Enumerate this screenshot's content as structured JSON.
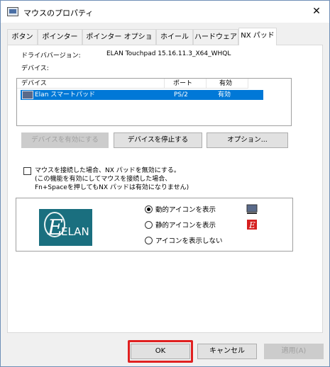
{
  "window": {
    "title": "マウスのプロパティ",
    "close_glyph": "✕"
  },
  "tabs": [
    {
      "label": "ボタン"
    },
    {
      "label": "ポインター"
    },
    {
      "label": "ポインター オプション"
    },
    {
      "label": "ホイール"
    },
    {
      "label": "ハードウェア"
    },
    {
      "label": "NX パッド"
    }
  ],
  "active_tab": "NX パッド",
  "driver": {
    "label": "ドライババージョン:",
    "value": "ELAN Touchpad 15.16.11.3_X64_WHQL"
  },
  "devices": {
    "label": "デバイス:",
    "columns": [
      "デバイス",
      "ポート",
      "有効"
    ],
    "rows": [
      {
        "device": "Elan スマートパッド",
        "port": "PS/2",
        "enabled": "有効",
        "selected": true
      }
    ]
  },
  "device_buttons": {
    "enable": "デバイスを有効にする",
    "stop": "デバイスを停止する",
    "options": "オプション..."
  },
  "disable_checkbox": {
    "line1": "マウスを接続した場合、NX パッドを無効にする。",
    "line2": "(この機能を有効にしてマウスを接続した場合、",
    "line3": "Fn+Spaceを押してもNX パッドは有効になりません)"
  },
  "logo": {
    "text": "ELAN"
  },
  "icon_options": [
    {
      "label": "動的アイコンを表示",
      "selected": true,
      "icon": "touchpad-icon"
    },
    {
      "label": "静的アイコンを表示",
      "selected": false,
      "icon": "elan-red-icon"
    },
    {
      "label": "アイコンを表示しない",
      "selected": false,
      "icon": ""
    }
  ],
  "footer": {
    "ok": "OK",
    "cancel": "キャンセル",
    "apply": "適用(A)"
  },
  "colors": {
    "selection": "#0078d7",
    "highlight_outline": "#e02020",
    "logo_bg": "#1a6f7f"
  }
}
